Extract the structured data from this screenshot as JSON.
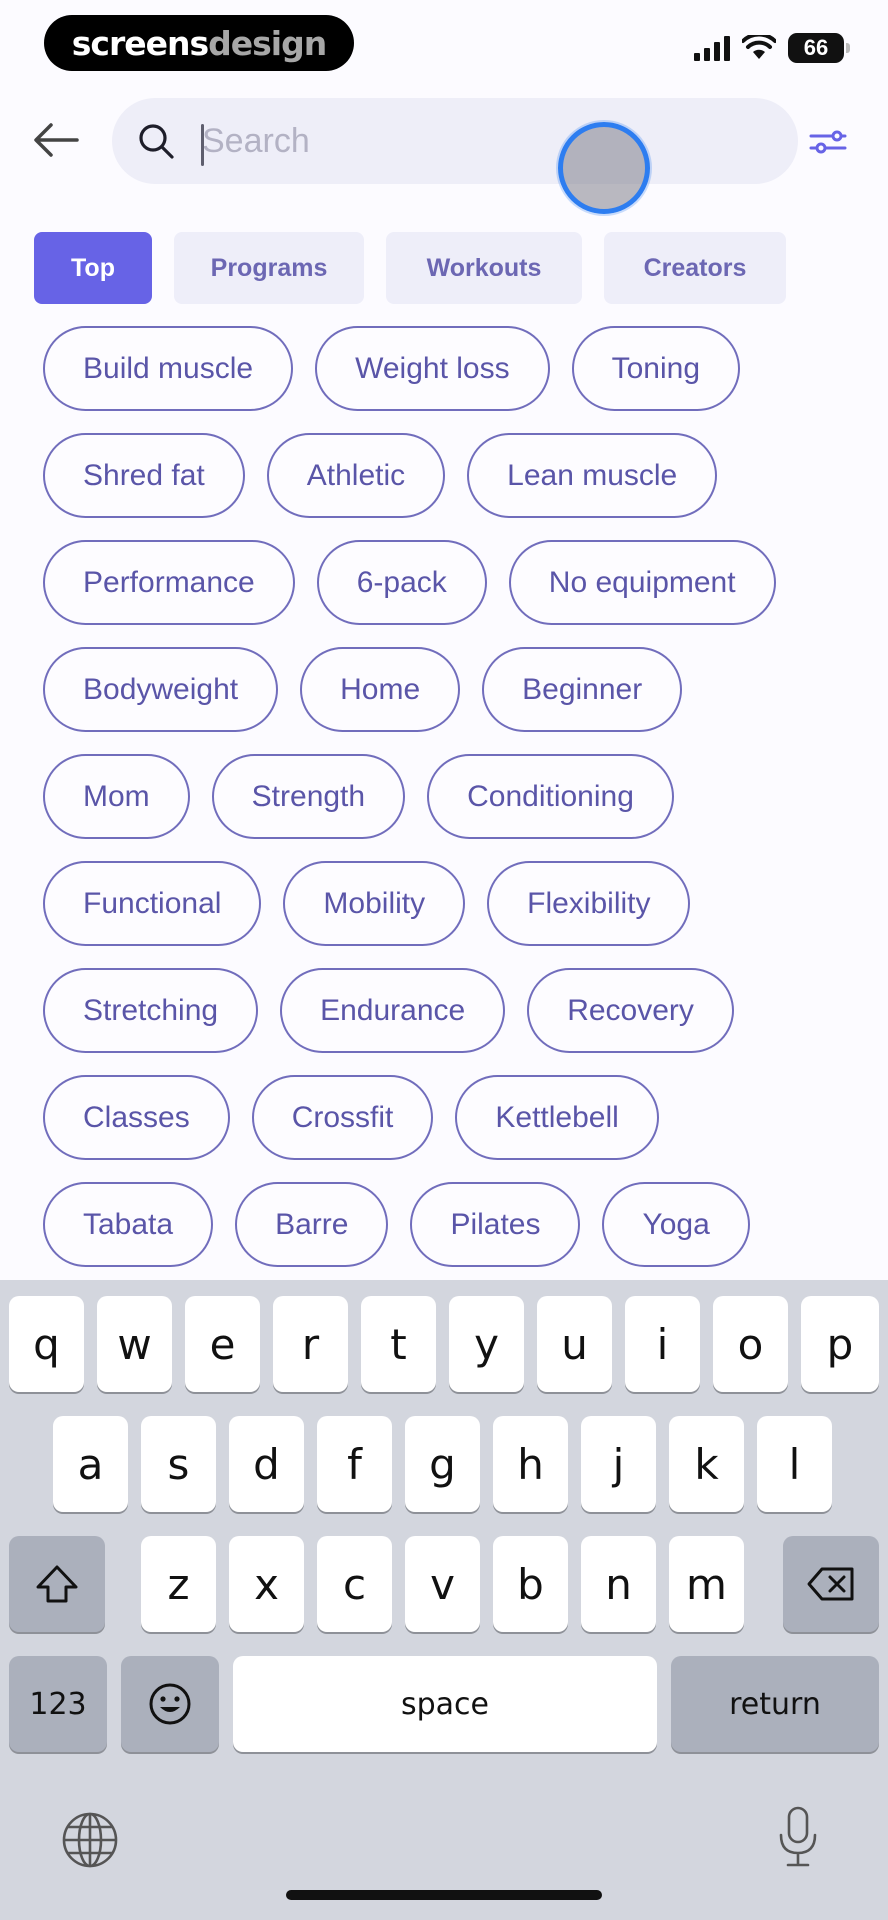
{
  "status_bar": {
    "brand_part1": "screens",
    "brand_part2": "design",
    "battery": "66"
  },
  "search": {
    "placeholder": "Search",
    "value": ""
  },
  "tabs": [
    {
      "label": "Top",
      "active": true
    },
    {
      "label": "Programs",
      "active": false
    },
    {
      "label": "Workouts",
      "active": false
    },
    {
      "label": "Creators",
      "active": false
    }
  ],
  "chips": [
    [
      "Build muscle",
      "Weight loss",
      "Toning"
    ],
    [
      "Shred fat",
      "Athletic",
      "Lean muscle"
    ],
    [
      "Performance",
      "6-pack",
      "No equipment"
    ],
    [
      "Bodyweight",
      "Home",
      "Beginner"
    ],
    [
      "Mom",
      "Strength",
      "Conditioning"
    ],
    [
      "Functional",
      "Mobility",
      "Flexibility"
    ],
    [
      "Stretching",
      "Endurance",
      "Recovery"
    ],
    [
      "Classes",
      "Crossfit",
      "Kettlebell"
    ],
    [
      "Tabata",
      "Barre",
      "Pilates",
      "Yoga"
    ]
  ],
  "keyboard": {
    "row1": [
      "q",
      "w",
      "e",
      "r",
      "t",
      "y",
      "u",
      "i",
      "o",
      "p"
    ],
    "row2": [
      "a",
      "s",
      "d",
      "f",
      "g",
      "h",
      "j",
      "k",
      "l"
    ],
    "row3": [
      "z",
      "x",
      "c",
      "v",
      "b",
      "n",
      "m"
    ],
    "numbers_label": "123",
    "space_label": "space",
    "return_label": "return"
  },
  "colors": {
    "accent": "#6763e6",
    "chip_text": "#5a55a8",
    "touch_ring": "#2d7df0"
  },
  "icons": {
    "back": "arrow-left-icon",
    "search": "magnifier-icon",
    "filter": "sliders-icon",
    "shift": "shift-arrow-icon",
    "delete": "backspace-icon",
    "emoji": "smiley-icon",
    "globe": "globe-icon",
    "mic": "microphone-icon"
  }
}
